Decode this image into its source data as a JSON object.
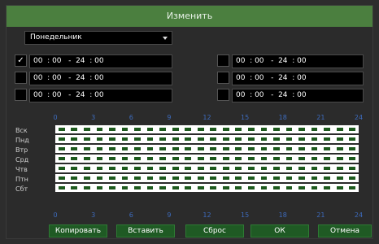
{
  "dialog": {
    "title": "Изменить"
  },
  "day_select": {
    "selected": "Понедельник"
  },
  "periods_left": [
    {
      "checked": true,
      "text": "00  : 00   -  24  : 00"
    },
    {
      "checked": false,
      "text": "00  : 00   -  24  : 00"
    },
    {
      "checked": false,
      "text": "00  : 00   -  24  : 00"
    }
  ],
  "periods_right": [
    {
      "checked": false,
      "text": "00  : 00   -  24  : 00"
    },
    {
      "checked": false,
      "text": "00  : 00   -  24  : 00"
    },
    {
      "checked": false,
      "text": "00  : 00   -  24  : 00"
    }
  ],
  "checkmark": "✓",
  "hours": [
    "0",
    "3",
    "6",
    "9",
    "12",
    "15",
    "18",
    "21",
    "24"
  ],
  "days": [
    "Вск",
    "Пнд",
    "Втр",
    "Срд",
    "Чтв",
    "Птн",
    "Сбт"
  ],
  "colors": {
    "scheduled": "#ffffff",
    "unscheduled": "#1e5a1e",
    "hour_labels": "#3d6bbd"
  },
  "buttons": {
    "copy": "Копировать",
    "paste": "Вставить",
    "reset": "Сброс",
    "ok": "ОК",
    "cancel": "Отмена"
  }
}
